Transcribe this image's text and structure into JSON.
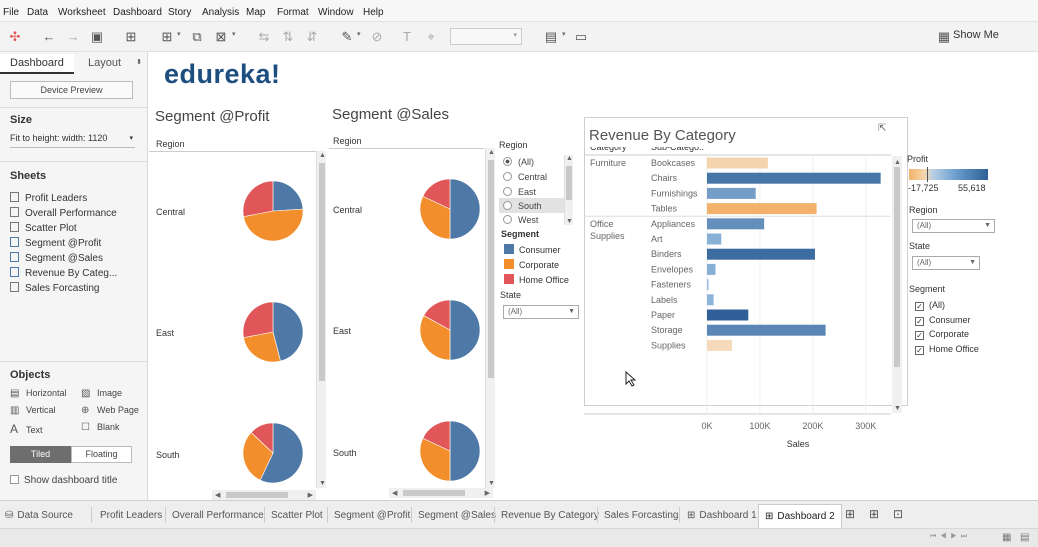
{
  "menu": [
    "File",
    "Data",
    "Worksheet",
    "Dashboard",
    "Story",
    "Analysis",
    "Map",
    "Format",
    "Window",
    "Help"
  ],
  "toolbar": {
    "show_me_label": "Show Me"
  },
  "leftpane": {
    "tabs": {
      "dashboard": "Dashboard",
      "layout": "Layout"
    },
    "device_preview_label": "Device Preview",
    "size_title": "Size",
    "size_value": "Fit to height: width: 1120",
    "sheets_title": "Sheets",
    "sheets": [
      "Profit Leaders",
      "Overall Performance",
      "Scatter Plot",
      "Segment @Profit",
      "Segment @Sales",
      "Revenue By Categ...",
      "Sales Forcasting"
    ],
    "objects_title": "Objects",
    "objects": [
      {
        "label": "Horizontal",
        "icon": "horizontal-icon"
      },
      {
        "label": "Image",
        "icon": "image-icon"
      },
      {
        "label": "Vertical",
        "icon": "vertical-icon"
      },
      {
        "label": "Web Page",
        "icon": "globe-icon"
      },
      {
        "label": "Text",
        "icon": "text-icon"
      },
      {
        "label": "Blank",
        "icon": "blank-icon"
      }
    ],
    "tiled_label": "Tiled",
    "floating_label": "Floating",
    "show_title_label": "Show dashboard title"
  },
  "logo_text": "edureka!",
  "profit_sheet": {
    "title": "Segment @Profit",
    "header": "Region",
    "rows": [
      {
        "region": "Central",
        "slices": [
          {
            "segment": "Consumer",
            "share": 0.24
          },
          {
            "segment": "Corporate",
            "share": 0.48
          },
          {
            "segment": "Home Office",
            "share": 0.28
          }
        ]
      },
      {
        "region": "East",
        "slices": [
          {
            "segment": "Consumer",
            "share": 0.46
          },
          {
            "segment": "Corporate",
            "share": 0.26
          },
          {
            "segment": "Home Office",
            "share": 0.28
          }
        ]
      },
      {
        "region": "South",
        "slices": [
          {
            "segment": "Consumer",
            "share": 0.57
          },
          {
            "segment": "Corporate",
            "share": 0.3
          },
          {
            "segment": "Home Office",
            "share": 0.13
          }
        ]
      }
    ]
  },
  "sales_sheet": {
    "title": "Segment @Sales",
    "header": "Region",
    "rows": [
      {
        "region": "Central",
        "slices": [
          {
            "segment": "Consumer",
            "share": 0.5
          },
          {
            "segment": "Corporate",
            "share": 0.32
          },
          {
            "segment": "Home Office",
            "share": 0.18
          }
        ]
      },
      {
        "region": "East",
        "slices": [
          {
            "segment": "Consumer",
            "share": 0.5
          },
          {
            "segment": "Corporate",
            "share": 0.33
          },
          {
            "segment": "Home Office",
            "share": 0.17
          }
        ]
      },
      {
        "region": "South",
        "slices": [
          {
            "segment": "Consumer",
            "share": 0.5
          },
          {
            "segment": "Corporate",
            "share": 0.32
          },
          {
            "segment": "Home Office",
            "share": 0.18
          }
        ]
      }
    ]
  },
  "region_filter": {
    "title": "Region",
    "options": [
      "(All)",
      "Central",
      "East",
      "South",
      "West"
    ],
    "selected": "(All)",
    "highlighted": "South"
  },
  "segment_legend": {
    "title": "Segment",
    "items": [
      {
        "label": "Consumer",
        "color": "#4e79a7"
      },
      {
        "label": "Corporate",
        "color": "#f28e2b"
      },
      {
        "label": "Home Office",
        "color": "#e15759"
      }
    ]
  },
  "state_filter_left": {
    "title": "State",
    "value": "(All)"
  },
  "right_filters": {
    "profit_title": "Profit",
    "profit_min": "-17,725",
    "profit_max": "55,618",
    "region_title": "Region",
    "region_value": "(All)",
    "state_title": "State",
    "state_value": "(All)",
    "segment_title": "Segment",
    "segment_options": [
      "(All)",
      "Consumer",
      "Corporate",
      "Home Office"
    ]
  },
  "chart_data": {
    "type": "bar",
    "title": "Revenue By Category",
    "col_headers": {
      "category": "Category",
      "subcategory": "Sub-Catego.."
    },
    "categories": [
      {
        "name": "Furniture",
        "label_lines": [
          "Furniture"
        ],
        "items": [
          {
            "sub": "Bookcases",
            "sales": 115000,
            "profit": -3500
          },
          {
            "sub": "Chairs",
            "sales": 328000,
            "profit": 27000
          },
          {
            "sub": "Furnishings",
            "sales": 92000,
            "profit": 13000
          },
          {
            "sub": "Tables",
            "sales": 207000,
            "profit": -17725
          }
        ]
      },
      {
        "name": "Office Supplies",
        "label_lines": [
          "Office",
          "Supplies"
        ],
        "items": [
          {
            "sub": "Appliances",
            "sales": 108000,
            "profit": 18000
          },
          {
            "sub": "Art",
            "sales": 27000,
            "profit": 6500
          },
          {
            "sub": "Binders",
            "sales": 204000,
            "profit": 30000
          },
          {
            "sub": "Envelopes",
            "sales": 16000,
            "profit": 7000
          },
          {
            "sub": "Fasteners",
            "sales": 3000,
            "profit": 950
          },
          {
            "sub": "Labels",
            "sales": 12500,
            "profit": 5500
          },
          {
            "sub": "Paper",
            "sales": 78000,
            "profit": 34000
          },
          {
            "sub": "Storage",
            "sales": 224000,
            "profit": 21000
          },
          {
            "sub": "Supplies",
            "sales": 47000,
            "profit": -1200
          }
        ]
      }
    ],
    "x_ticks": [
      "0K",
      "100K",
      "200K",
      "300K"
    ],
    "x_tick_values": [
      0,
      100000,
      200000,
      300000
    ],
    "xlim": [
      0,
      340000
    ],
    "xlabel": "Sales",
    "color_by": "Profit",
    "color_range": [
      -17725,
      55618
    ]
  },
  "bottom_tabs": [
    "Data Source",
    "Profit Leaders",
    "Overall Performance",
    "Scatter Plot",
    "Segment @Profit",
    "Segment @Sales",
    "Revenue By Category",
    "Sales Forcasting",
    "Dashboard 1",
    "Dashboard 2"
  ],
  "active_tab": "Dashboard 2"
}
